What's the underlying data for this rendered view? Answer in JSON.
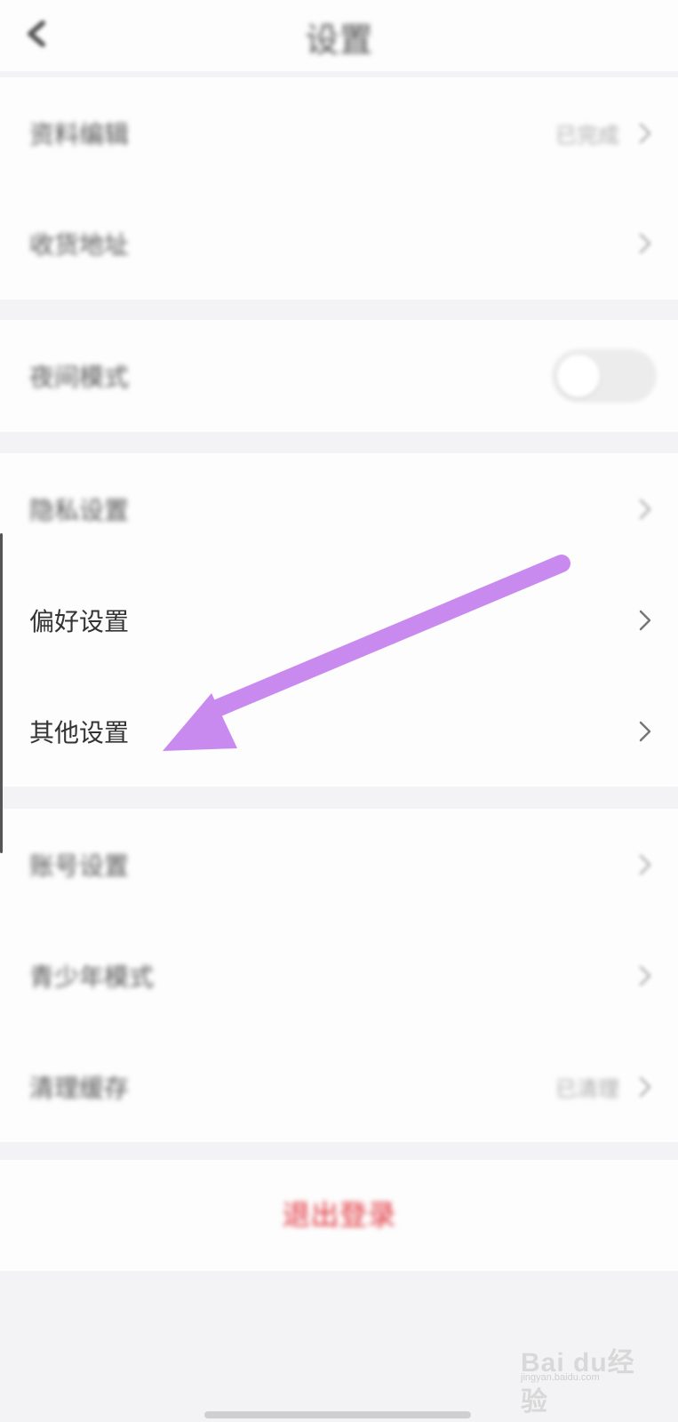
{
  "header": {
    "title": "设置"
  },
  "groups": [
    {
      "rows": [
        {
          "label": "资料编辑",
          "value": "已完成",
          "has_chevron": true
        },
        {
          "label": "收货地址",
          "value": "",
          "has_chevron": true
        }
      ]
    },
    {
      "rows": [
        {
          "label": "夜间模式",
          "toggle_on": false
        }
      ]
    },
    {
      "rows": [
        {
          "label": "隐私设置",
          "has_chevron": true
        },
        {
          "label": "偏好设置",
          "has_chevron": true
        },
        {
          "label": "其他设置",
          "has_chevron": true
        }
      ]
    },
    {
      "rows": [
        {
          "label": "账号设置",
          "has_chevron": true
        },
        {
          "label": "青少年模式",
          "has_chevron": true
        },
        {
          "label": "清理缓存",
          "value": "已清理",
          "has_chevron": true
        }
      ]
    }
  ],
  "logout": {
    "label": "退出登录"
  },
  "annotation": {
    "arrow_color": "#c98af0",
    "arrow_target": "其他设置"
  },
  "watermark": {
    "text": "Bai du经验",
    "subtext": "jingyan.baidu.com"
  },
  "colors": {
    "background": "#f3f3f5",
    "surface": "#fdfdfd",
    "logout_red": "#e0313a",
    "chevron": "#888888"
  }
}
